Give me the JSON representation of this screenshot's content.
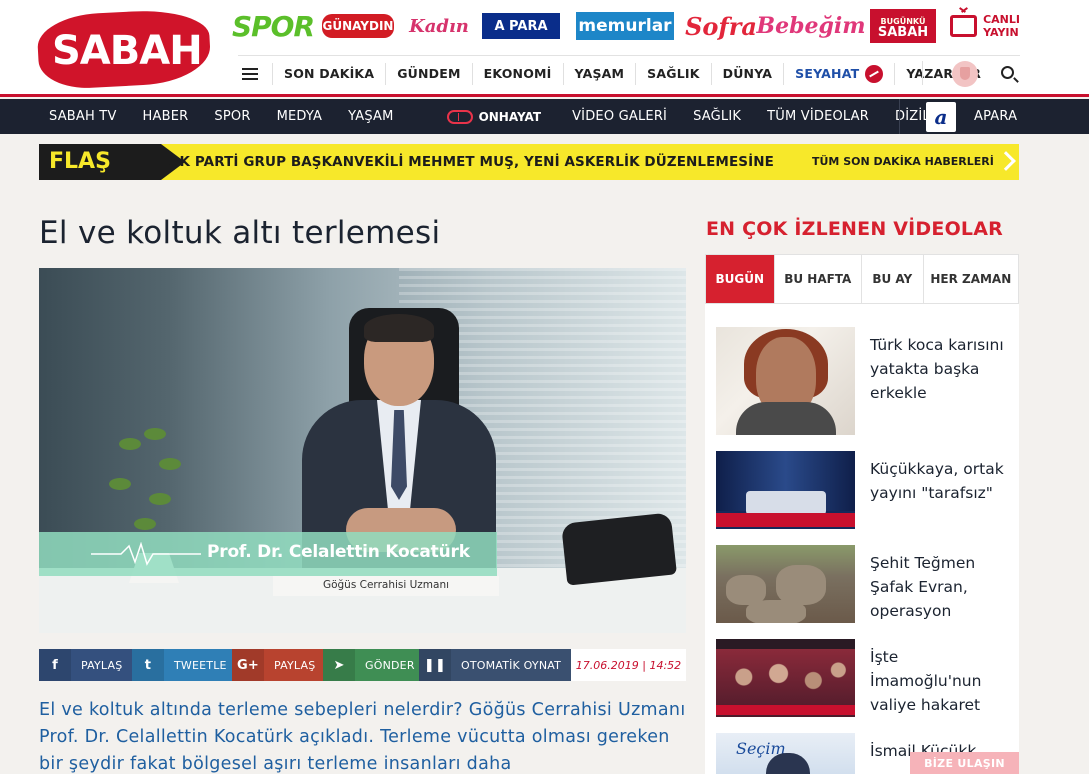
{
  "header": {
    "logo_text": "SABAH",
    "brands": {
      "spor": "SPOR",
      "gunaydin": "GÜNAYDIN",
      "kadin": "Kadın",
      "apara": "A PARA",
      "memurlar": "memurlar",
      "sofra": "Sofra",
      "bebegim": "Bebeğim",
      "bugunku_top": "BUGÜNKÜ",
      "bugunku_bottom": "SABAH"
    },
    "live": {
      "line1": "CANLI",
      "line2": "YAYIN"
    }
  },
  "main_nav": {
    "items": [
      "SON DAKİKA",
      "GÜNDEM",
      "EKONOMİ",
      "YAŞAM",
      "SAĞLIK",
      "DÜNYA",
      "SEYAHAT",
      "YAZARLAR"
    ]
  },
  "dark_nav": {
    "items": [
      "SABAH TV",
      "HABER",
      "SPOR",
      "MEDYA",
      "YAŞAM"
    ],
    "onhayat": "ONHAYAT",
    "items2": [
      "VİDEO GALERİ",
      "SAĞLIK",
      "TÜM VİDEOLAR",
      "DİZİLER"
    ],
    "apara_logo": "a",
    "apara": "APARA"
  },
  "flash": {
    "tag": "FLAŞ",
    "headline": "AK PARTİ GRUP BAŞKANVEKİLİ MEHMET MUŞ, YENİ ASKERLİK DÜZENLEMESİNE İLİ...",
    "link": "TÜM SON DAKİKA HABERLERİ"
  },
  "article": {
    "title": "El ve koltuk altı terlemesi",
    "video": {
      "person_name": "Prof. Dr. Celalettin Kocatürk",
      "person_role": "Göğüs Cerrahisi Uzmanı"
    },
    "share": {
      "facebook_icon": "f",
      "facebook": "PAYLAŞ",
      "twitter_icon": "t",
      "twitter": "TWEETLE",
      "google_icon": "G+",
      "google": "PAYLAŞ",
      "send_icon": "➤",
      "send": "GÖNDER",
      "pause_icon": "❚❚",
      "autoplay": "OTOMATİK OYNAT",
      "date": "17.06.2019 | 14:52"
    },
    "summary": "El ve koltuk altında terleme sebepleri nelerdir? Göğüs Cerrahisi Uzmanı Prof. Dr. Celallettin Kocatürk açıkladı. Terleme vücutta olması gereken bir şeydir fakat bölgesel aşırı terleme insanları daha"
  },
  "sidebar": {
    "title": "EN ÇOK İZLENEN VİDEOLAR",
    "tabs": [
      "BUGÜN",
      "BU HAFTA",
      "BU AY",
      "HER ZAMAN"
    ],
    "active_tab": "BUGÜN",
    "videos": [
      "Türk koca karısını yatakta başka erkekle",
      "Küçükkaya, ortak yayını \"tarafsız\"",
      "Şehit Teğmen Şafak Evran, operasyon",
      "İşte İmamoğlu'nun valiye hakaret",
      "İsmail Küçükk..."
    ],
    "thumb5_text": "Seçim",
    "cta": "BİZE ULAŞIN"
  },
  "colors": {
    "brand_red": "#c8102e",
    "dark_nav": "#1c2230",
    "flash_yellow": "#f7e82a",
    "link_blue": "#1f5fa0"
  }
}
